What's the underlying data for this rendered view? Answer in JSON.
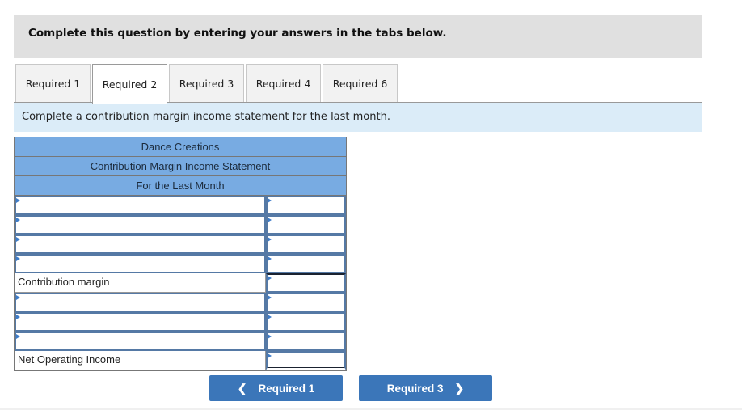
{
  "instruction": "Complete this question by entering your answers in the tabs below.",
  "tabs": [
    {
      "label": "Required 1",
      "active": false
    },
    {
      "label": "Required 2",
      "active": true
    },
    {
      "label": "Required 3",
      "active": false
    },
    {
      "label": "Required 4",
      "active": false
    },
    {
      "label": "Required 6",
      "active": false
    }
  ],
  "subprompt": "Complete a contribution margin income statement for the last month.",
  "statement": {
    "company": "Dance Creations",
    "title": "Contribution Margin Income Statement",
    "period": "For the Last Month",
    "rows": [
      {
        "label": "",
        "amount": "",
        "label_editable": true
      },
      {
        "label": "",
        "amount": "",
        "label_editable": true
      },
      {
        "label": "",
        "amount": "",
        "label_editable": true
      },
      {
        "label": "",
        "amount": "",
        "label_editable": true
      },
      {
        "label": "Contribution margin",
        "amount": "",
        "label_editable": false
      },
      {
        "label": "",
        "amount": "",
        "label_editable": true
      },
      {
        "label": "",
        "amount": "",
        "label_editable": true
      },
      {
        "label": "",
        "amount": "",
        "label_editable": true
      },
      {
        "label": "Net Operating Income",
        "amount": "",
        "label_editable": false
      }
    ]
  },
  "navigation": {
    "prev_label": "Required 1",
    "next_label": "Required 3",
    "prev_icon": "chevron-left-icon",
    "next_icon": "chevron-right-icon"
  }
}
